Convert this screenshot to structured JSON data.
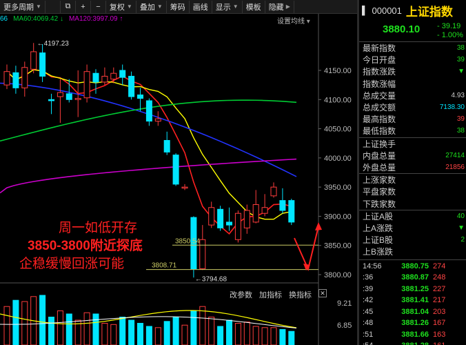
{
  "toolbar": {
    "period": "更多周期",
    "fuquan": "复权",
    "overlay": "叠加",
    "filter": "筹码",
    "draw": "画线",
    "display": "显示",
    "template": "模板",
    "hide": "隐藏"
  },
  "ma_legend": {
    "partial": "66",
    "ma60": "MA60:4069.42 ↓",
    "ma120": "MA120:3997.09 ↑",
    "settings": "设置均线"
  },
  "colors": {
    "up": "#ff3c3c",
    "down": "#00e5ff",
    "ma_yellow": "#ffff00",
    "ma_red": "#ff2020",
    "ma_blue": "#2233ff",
    "ma60": "#00cc33",
    "ma120": "#cc00cc",
    "level_line": "#cccc66"
  },
  "chart_data": {
    "type": "candlestick",
    "y_ticks": [
      "4150.00",
      "4100.00",
      "4050.00",
      "4000.00",
      "3950.00",
      "3900.00",
      "3850.00",
      "3800.00"
    ],
    "ylim": [
      3780,
      4210
    ],
    "high_label": "4197.23",
    "low_label": "3794.68",
    "level_1": "3850.54",
    "level_2": "3808.71",
    "candles": [
      [
        4125,
        4148,
        4160,
        4118
      ],
      [
        4146,
        4120,
        4158,
        4110
      ],
      [
        4120,
        4155,
        4165,
        4105
      ],
      [
        4152,
        4182,
        4197,
        4145
      ],
      [
        4180,
        4140,
        4195,
        4130
      ],
      [
        4100,
        4098,
        4110,
        4075
      ],
      [
        4105,
        4112,
        4135,
        4060
      ],
      [
        4110,
        4100,
        4135,
        4095
      ],
      [
        4100,
        4102,
        4150,
        4070
      ],
      [
        4103,
        4148,
        4160,
        4095
      ],
      [
        4145,
        4130,
        4152,
        4110
      ],
      [
        4130,
        4140,
        4155,
        4125
      ],
      [
        4135,
        4145,
        4155,
        4128
      ],
      [
        4150,
        4138,
        4160,
        4125
      ],
      [
        4140,
        4105,
        4148,
        4100
      ],
      [
        4108,
        4102,
        4120,
        4080
      ],
      [
        4098,
        4063,
        4102,
        4055
      ],
      [
        4063,
        4067,
        4080,
        4055
      ],
      [
        4030,
        4010,
        4045,
        4005
      ],
      [
        4005,
        3955,
        4008,
        3952
      ],
      [
        3950,
        3950,
        3955,
        3945
      ],
      [
        3898,
        3810,
        3900,
        3795
      ],
      [
        3810,
        3860,
        3885,
        3808
      ],
      [
        3885,
        3915,
        3925,
        3880
      ],
      [
        3912,
        3880,
        3918,
        3875
      ],
      [
        3890,
        3885,
        3915,
        3875
      ],
      [
        3860,
        3905,
        3910,
        3855
      ],
      [
        3880,
        3910,
        3920,
        3870
      ],
      [
        3890,
        3920,
        3945,
        3888
      ],
      [
        3905,
        3915,
        3938,
        3900
      ],
      [
        3935,
        3950,
        3958,
        3932
      ],
      [
        3927,
        3910,
        3948,
        3905
      ],
      [
        3927,
        3890,
        3930,
        3885
      ]
    ],
    "volume_axis": [
      "9.21",
      "6.85"
    ]
  },
  "annotation": {
    "line1": "周一如低开存",
    "line2": "3850-3800附近探底",
    "line3": "企稳缓慢回涨可能"
  },
  "bottom_tools": {
    "params": "改参数",
    "add": "加指标",
    "switch": "换指标"
  },
  "panel": {
    "code": "000001",
    "name": "上证指数",
    "price": "3880.10",
    "change": "- 39.19",
    "pct": "- 1.00%",
    "rows_a": [
      {
        "label": "最新指数",
        "value": "38",
        "color": "#1ee11e"
      },
      {
        "label": "今日开盘",
        "value": "39",
        "color": "#1ee11e"
      },
      {
        "label": "指数涨跌",
        "value": "▼",
        "color": "#1ee11e"
      },
      {
        "label": "指数涨幅",
        "value": "",
        "color": "#1ee11e"
      },
      {
        "label": "总成交量",
        "value": "4.93",
        "color": "#ccc"
      },
      {
        "label": "总成交额",
        "value": "7138.30",
        "color": "#00e5ff"
      },
      {
        "label": "最高指数",
        "value": "39",
        "color": "#ff4444"
      },
      {
        "label": "最低指数",
        "value": "38",
        "color": "#1ee11e"
      }
    ],
    "rows_b": [
      {
        "label": "上证换手",
        "value": "",
        "color": "#ccc"
      },
      {
        "label": "内盘总量",
        "value": "27414",
        "color": "#1ee11e"
      },
      {
        "label": "外盘总量",
        "value": "21856",
        "color": "#ff4444"
      }
    ],
    "rows_c": [
      {
        "label": "上涨家数",
        "value": "",
        "color": "#ccc"
      },
      {
        "label": "平盘家数",
        "value": "",
        "color": "#ccc"
      },
      {
        "label": "下跌家数",
        "value": "",
        "color": "#ccc"
      }
    ],
    "rows_d": [
      {
        "label": "上证A股",
        "value": "40",
        "color": "#1ee11e"
      },
      {
        "label": "上A涨跌",
        "value": "▼",
        "color": "#1ee11e"
      },
      {
        "label": "上证B股",
        "value": "2",
        "color": "#1ee11e"
      },
      {
        "label": "上B涨跌",
        "value": "",
        "color": "#ccc"
      }
    ],
    "trades": [
      {
        "time": "14:56",
        "price": "3880.75",
        "vol": "274"
      },
      {
        "time": ":36",
        "price": "3880.87",
        "vol": "248"
      },
      {
        "time": ":39",
        "price": "3881.25",
        "vol": "227"
      },
      {
        "time": ":42",
        "price": "3881.41",
        "vol": "217"
      },
      {
        "time": ":45",
        "price": "3881.04",
        "vol": "203"
      },
      {
        "time": ":48",
        "price": "3881.26",
        "vol": "167"
      },
      {
        "time": ":51",
        "price": "3881.66",
        "vol": "163"
      },
      {
        "time": ":54",
        "price": "3881.28",
        "vol": "161"
      }
    ]
  }
}
